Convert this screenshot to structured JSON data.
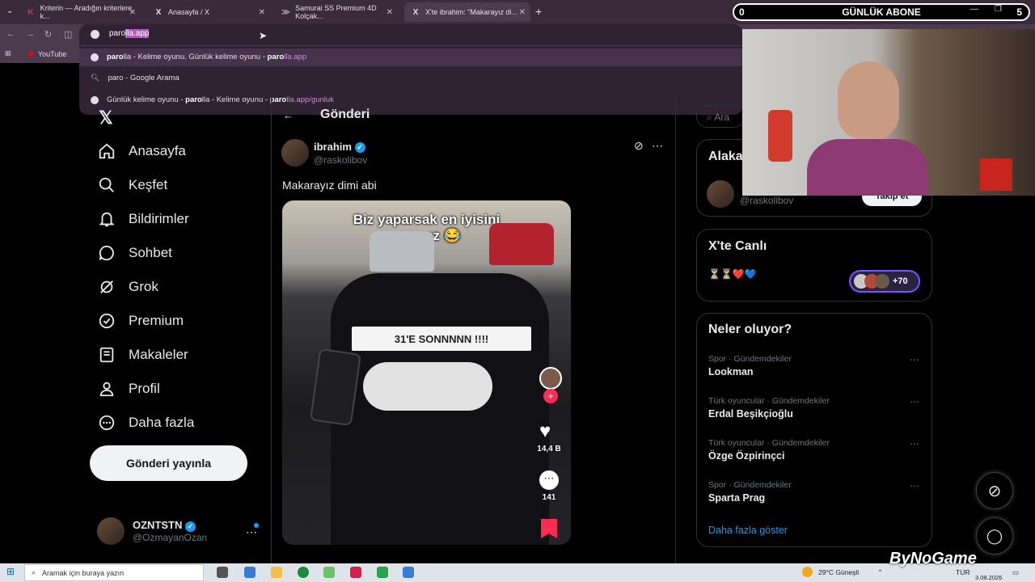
{
  "browser": {
    "tabs": [
      {
        "icon": "K",
        "title": "Kriterin — Aradığın kriterlere k..."
      },
      {
        "icon": "X",
        "title": "Anasayfa / X"
      },
      {
        "icon": "samurai-icon",
        "title": "Samurai SS Premium 4D Kolçak..."
      },
      {
        "icon": "X",
        "title": "X'te ibrahim: \"Makarayız di..."
      }
    ],
    "address_typed": "paro",
    "address_completion": "lla.app",
    "bookmarks": [
      "YouTube"
    ],
    "suggestions": [
      {
        "bold": "paro",
        "rest": "lla - Kelime oyunu. Günlük kelime oyunu - ",
        "link_bold": "paro",
        "link_rest": "lla.app"
      },
      {
        "text": "paro - Google Arama"
      },
      {
        "pre": "Günlük kelime oyunu - ",
        "bold": "paro",
        "mid": "lla - Kelime oyunu - ",
        "link_bold": "paro",
        "link_rest": "lla.app/gunluk"
      }
    ]
  },
  "stream_banner": {
    "left": "0",
    "title": "GÜNLÜK ABONE",
    "right": "5"
  },
  "sidebar": {
    "items": [
      {
        "label": "Anasayfa",
        "icon": "home-icon"
      },
      {
        "label": "Keşfet",
        "icon": "search-icon"
      },
      {
        "label": "Bildirimler",
        "icon": "bell-icon"
      },
      {
        "label": "Sohbet",
        "icon": "chat-icon"
      },
      {
        "label": "Grok",
        "icon": "grok-icon"
      },
      {
        "label": "Premium",
        "icon": "premium-icon"
      },
      {
        "label": "Makaleler",
        "icon": "article-icon"
      },
      {
        "label": "Profil",
        "icon": "person-icon"
      },
      {
        "label": "Daha fazla",
        "icon": "more-icon"
      }
    ],
    "post_button": "Gönderi yayınla",
    "account": {
      "name": "OZNTSTN",
      "handle": "@OzmayanOzan"
    }
  },
  "tweet": {
    "header_partial": "Gönderi",
    "author": "ibrahim",
    "handle": "@raskolibov",
    "text": "Makarayız dimi abi",
    "media_caption_line1": "Biz yaparsak en iyisini",
    "media_caption_line2": "yaparız 😂",
    "media_sign": "31'E SONNNNN !!!!",
    "likes": "14,4 B",
    "comments": "141"
  },
  "right": {
    "search_placeholder": "Ara",
    "relevant_title": "Alaka",
    "relevant_handle": "@raskolibov",
    "follow_label": "Takip et",
    "live_title": "X'te Canlı",
    "live_emojis": "⏳⏳❤️💙",
    "live_count": "+70",
    "trends_title": "Neler oluyor?",
    "trends": [
      {
        "category": "Spor · Gündemdekiler",
        "name": "Lookman"
      },
      {
        "category": "Türk oyuncular · Gündemdekiler",
        "name": "Erdal Beşikçioğlu"
      },
      {
        "category": "Türk oyuncular · Gündemdekiler",
        "name": "Özge Özpirinçci"
      },
      {
        "category": "Spor · Gündemdekiler",
        "name": "Sparta Prag"
      }
    ],
    "show_more": "Daha fazla göster"
  },
  "taskbar": {
    "search_placeholder": "Aramak için buraya yazın",
    "weather": "29°C Güneşli",
    "lang": "TUR",
    "date": "3.08.2026",
    "watermark": "ByNoGame"
  }
}
